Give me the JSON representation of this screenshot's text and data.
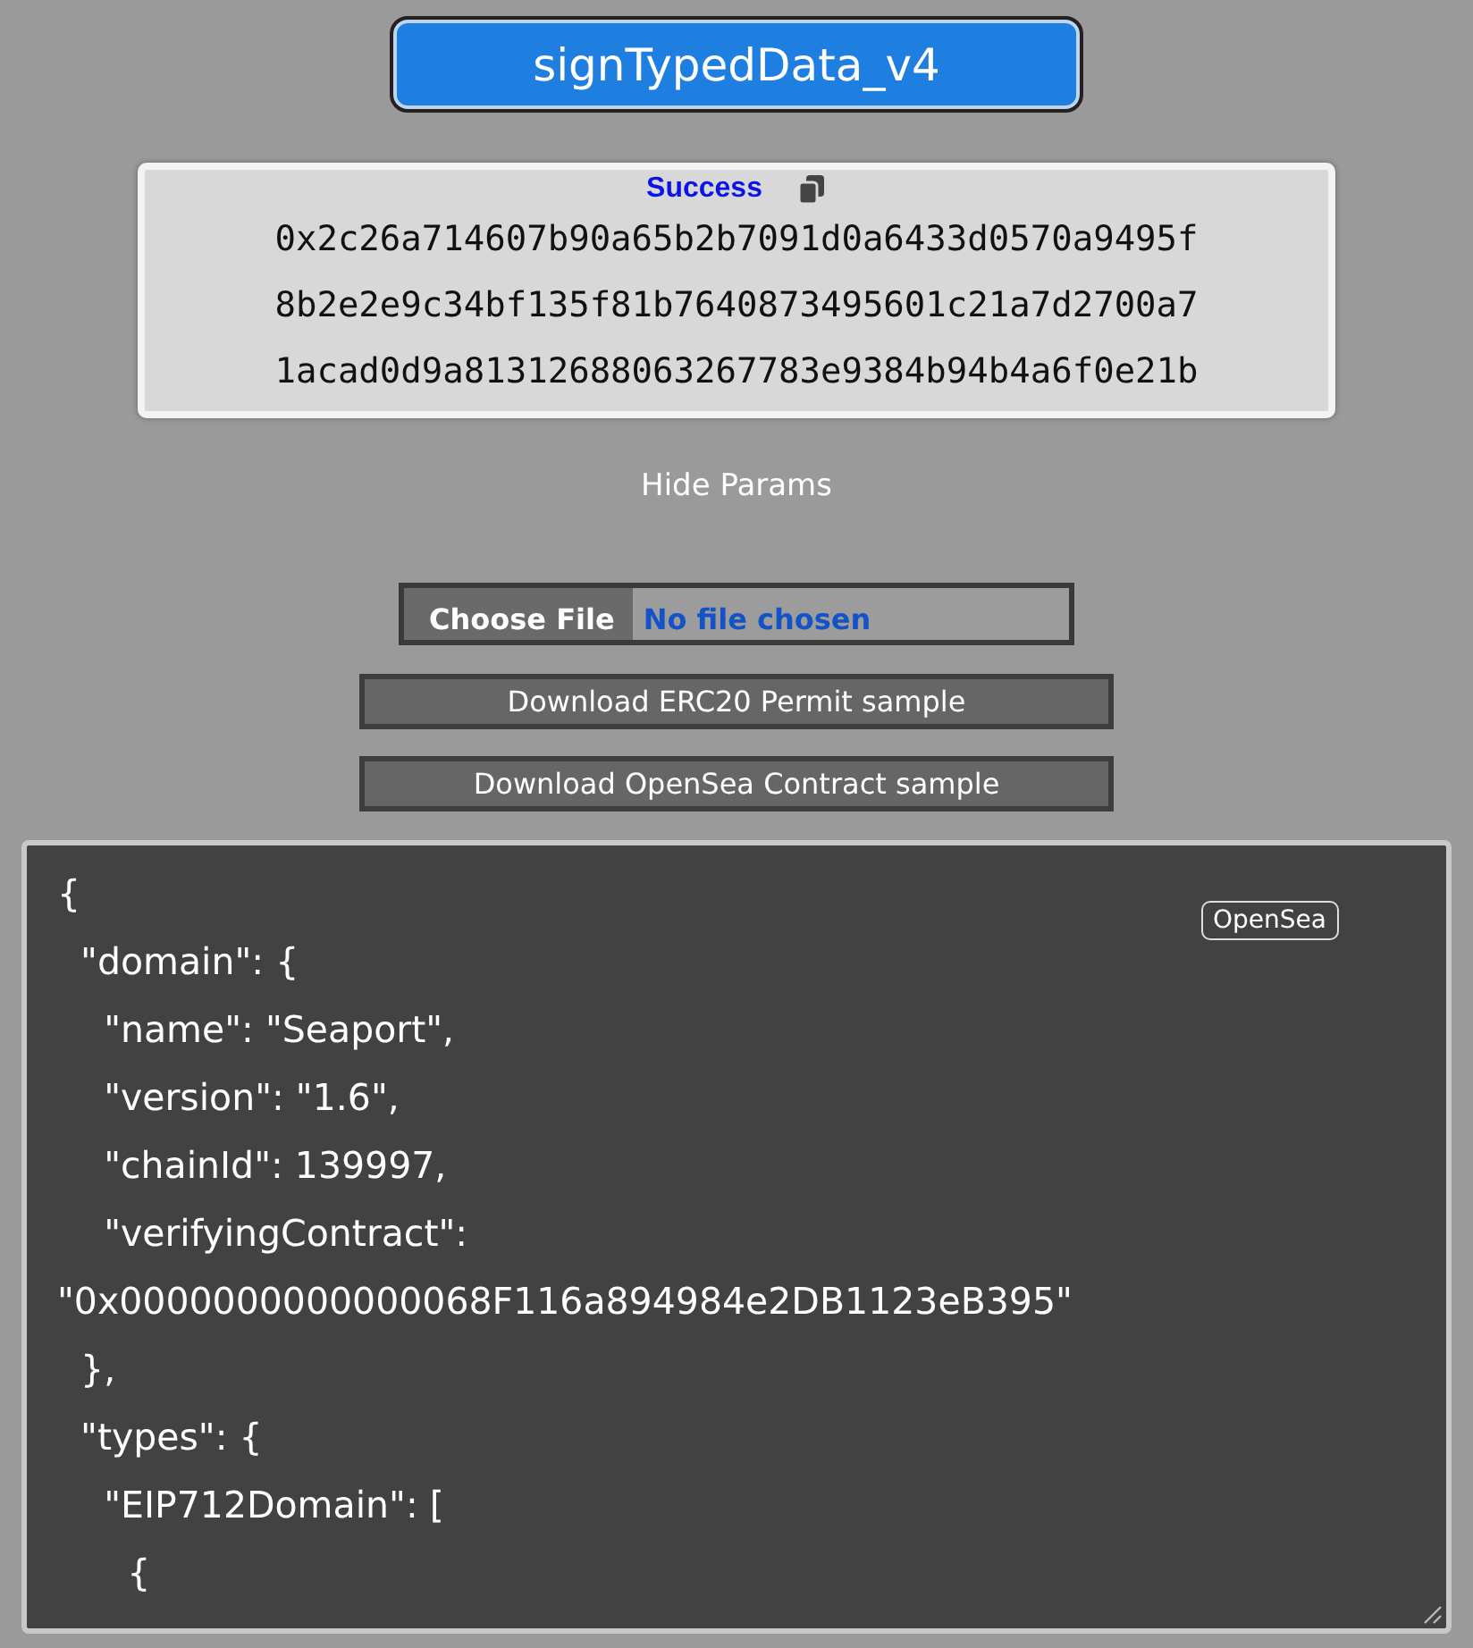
{
  "method_button": {
    "label": "signTypedData_v4"
  },
  "result": {
    "status": "Success",
    "lines": [
      "0x2c26a714607b90a65b2b7091d0a6433d0570a9495f",
      "8b2e2e9c34bf135f81b7640873495601c21a7d2700a7",
      "1acad0d9a81312688063267783e9384b94b4a6f0e21b"
    ]
  },
  "params_toggle": {
    "label": "Hide Params"
  },
  "file_input": {
    "button": "Choose File",
    "status": "No file chosen"
  },
  "download_buttons": [
    "Download ERC20 Permit sample",
    "Download OpenSea Contract sample"
  ],
  "editor": {
    "badge": "OpenSea",
    "lines": [
      "{",
      "  \"domain\": {",
      "    \"name\": \"Seaport\",",
      "    \"version\": \"1.6\",",
      "    \"chainId\": 139997,",
      "    \"verifyingContract\":",
      "\"0x0000000000000068F116a894984e2DB1123eB395\"",
      "  },",
      "  \"types\": {",
      "    \"EIP712Domain\": [",
      "      {"
    ]
  }
}
